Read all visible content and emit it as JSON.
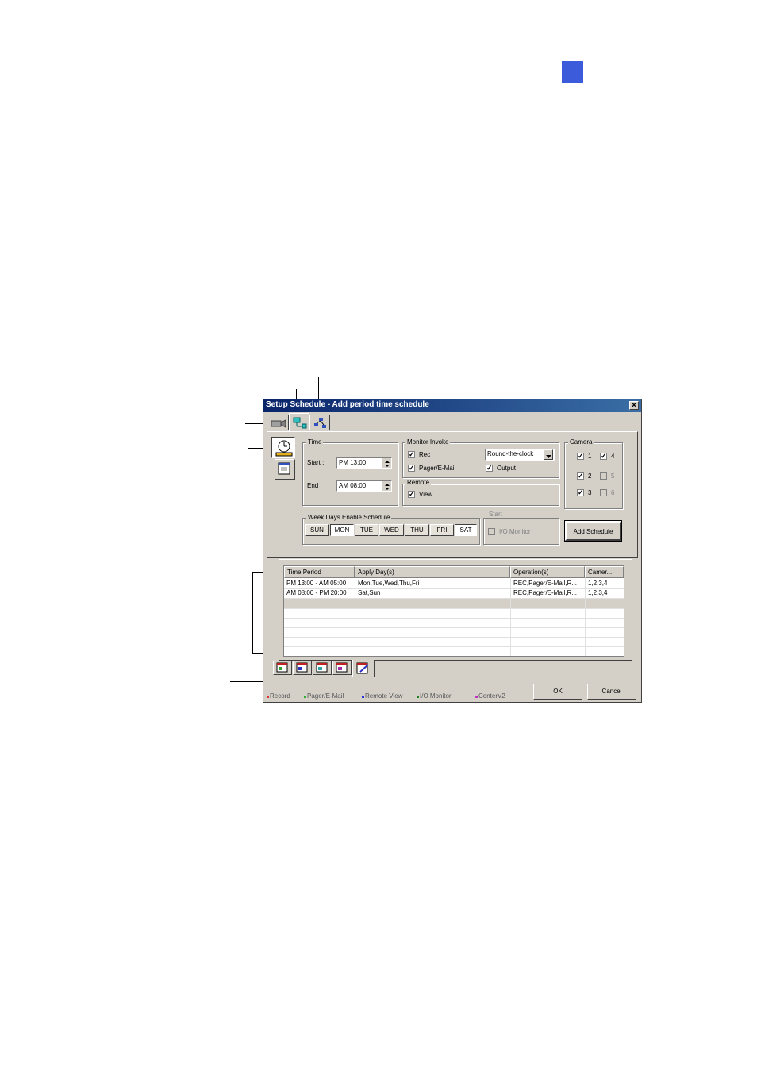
{
  "window": {
    "title": "Setup Schedule - Add period time schedule",
    "close_glyph": "✕"
  },
  "time": {
    "group_label": "Time",
    "start_label": "Start :",
    "start_value": "PM 13:00",
    "end_label": "End :",
    "end_value": "AM 08:00"
  },
  "monitor_invoke": {
    "group_label": "Monitor Invoke",
    "rec_label": "Rec",
    "pager_label": "Pager/E-Mail",
    "output_label": "Output",
    "mode_value": "Round-the-clock"
  },
  "remote": {
    "group_label": "Remote",
    "view_label": "View"
  },
  "camera": {
    "group_label": "Camera",
    "items": [
      "1",
      "2",
      "3",
      "4",
      "5",
      "6"
    ]
  },
  "week_days": {
    "group_label": "Week Days Enable Schedule",
    "days": [
      "SUN",
      "MON",
      "TUE",
      "WED",
      "THU",
      "FRI",
      "SAT"
    ]
  },
  "start": {
    "group_label": "Start",
    "io_monitor_label": "I/O Monitor"
  },
  "add_schedule_label": "Add Schedule",
  "table": {
    "columns": [
      "Time Period",
      "Apply Day(s)",
      "Operation(s)",
      "Camer..."
    ],
    "rows": [
      [
        "PM 13:00 - AM 05:00",
        "Mon,Tue,Wed,Thu,Fri",
        "REC,Pager/E-Mail,R...",
        "1,2,3,4"
      ],
      [
        "AM 08:00 - PM 20:00",
        "Sat,Sun",
        "REC,Pager/E-Mail,R...",
        "1,2,3,4"
      ]
    ]
  },
  "legend": {
    "items": [
      {
        "label": "Record",
        "color": "#e03030"
      },
      {
        "label": "Pager/E-Mail",
        "color": "#30b030"
      },
      {
        "label": "Remote View",
        "color": "#3030e0"
      },
      {
        "label": "I/O Monitor",
        "color": "#208020"
      },
      {
        "label": "CenterV2",
        "color": "#c030c0"
      }
    ]
  },
  "buttons": {
    "ok": "OK",
    "cancel": "Cancel"
  },
  "colors": {
    "accent_square": "#3b5bdb",
    "titlebar": "#0a246a"
  }
}
